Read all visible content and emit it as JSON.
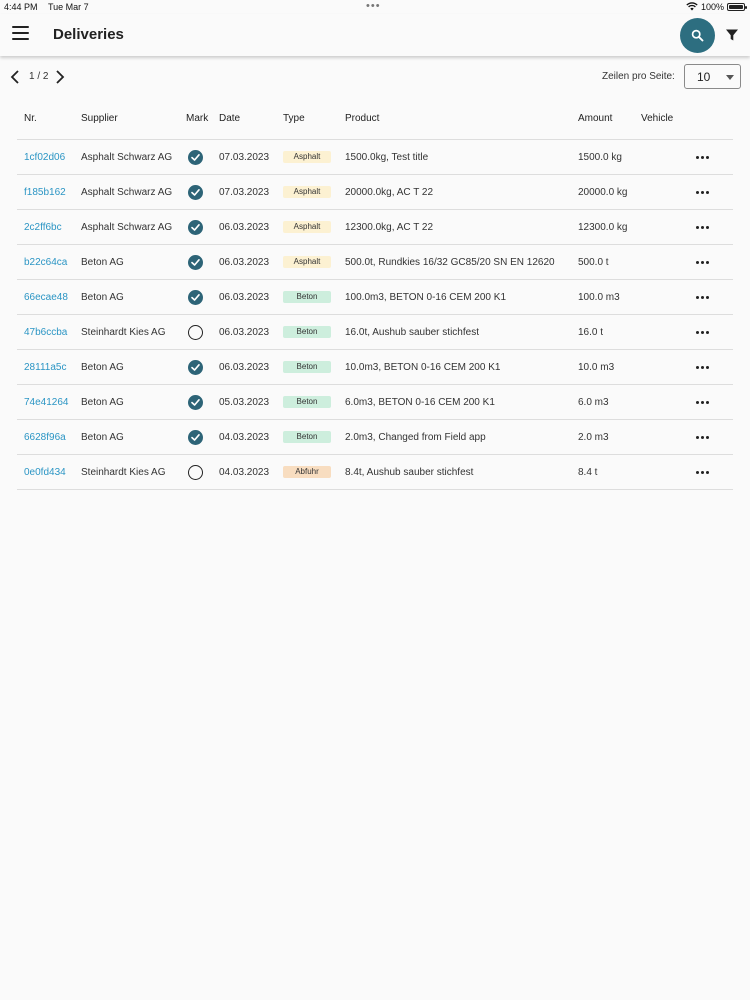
{
  "status_bar": {
    "time": "4:44 PM",
    "date": "Tue Mar 7",
    "battery": "100%"
  },
  "app_bar": {
    "title": "Deliveries",
    "accent_color": "#2d6e80"
  },
  "pagination": {
    "page": "1 / 2",
    "rows_label": "Zeilen pro Seite:",
    "rows_value": "10"
  },
  "columns": [
    "Nr.",
    "Supplier",
    "Mark",
    "Date",
    "Type",
    "Product",
    "Amount",
    "Vehicle"
  ],
  "rows": [
    {
      "id": "1cf02d06",
      "supplier": "Asphalt Schwarz AG",
      "mark": true,
      "date": "07.03.2023",
      "type": "Asphalt",
      "product": "1500.0kg, Test title",
      "amount": "1500.0 kg"
    },
    {
      "id": "f185b162",
      "supplier": "Asphalt Schwarz AG",
      "mark": true,
      "date": "07.03.2023",
      "type": "Asphalt",
      "product": "20000.0kg, AC T 22",
      "amount": "20000.0 kg"
    },
    {
      "id": "2c2ff6bc",
      "supplier": "Asphalt Schwarz AG",
      "mark": true,
      "date": "06.03.2023",
      "type": "Asphalt",
      "product": "12300.0kg, AC T 22",
      "amount": "12300.0 kg"
    },
    {
      "id": "b22c64ca",
      "supplier": "Beton AG",
      "mark": true,
      "date": "06.03.2023",
      "type": "Asphalt",
      "product": "500.0t, Rundkies 16/32 GC85/20 SN EN 12620",
      "amount": "500.0 t"
    },
    {
      "id": "66ecae48",
      "supplier": "Beton AG",
      "mark": true,
      "date": "06.03.2023",
      "type": "Beton",
      "product": "100.0m3, BETON 0-16 CEM 200 K1",
      "amount": "100.0 m3"
    },
    {
      "id": "47b6ccba",
      "supplier": "Steinhardt Kies AG",
      "mark": false,
      "date": "06.03.2023",
      "type": "Beton",
      "product": "16.0t, Aushub sauber stichfest",
      "amount": "16.0 t"
    },
    {
      "id": "28111a5c",
      "supplier": "Beton AG",
      "mark": true,
      "date": "06.03.2023",
      "type": "Beton",
      "product": "10.0m3, BETON 0-16 CEM 200 K1",
      "amount": "10.0 m3"
    },
    {
      "id": "74e41264",
      "supplier": "Beton AG",
      "mark": true,
      "date": "05.03.2023",
      "type": "Beton",
      "product": "6.0m3, BETON 0-16 CEM 200 K1",
      "amount": "6.0 m3"
    },
    {
      "id": "6628f96a",
      "supplier": "Beton AG",
      "mark": true,
      "date": "04.03.2023",
      "type": "Beton",
      "product": "2.0m3, Changed from Field app",
      "amount": "2.0 m3"
    },
    {
      "id": "0e0fd434",
      "supplier": "Steinhardt Kies AG",
      "mark": false,
      "date": "04.03.2023",
      "type": "Abfuhr",
      "product": "8.4t, Aushub sauber stichfest",
      "amount": "8.4 t"
    }
  ]
}
